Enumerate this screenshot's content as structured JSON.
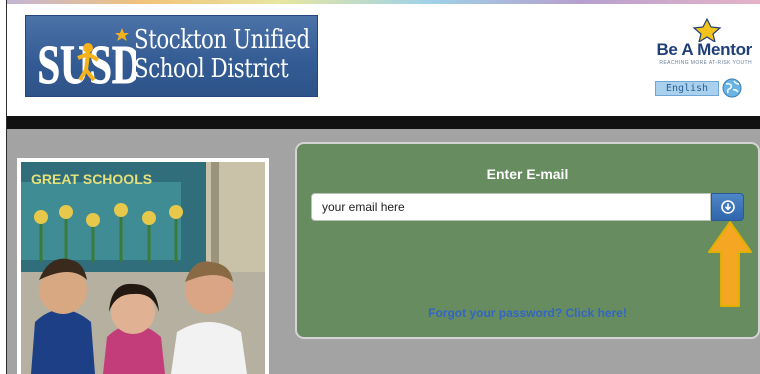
{
  "header": {
    "logo": {
      "letters": "SUSD",
      "line1": "Stockton Unified",
      "line2": "School District"
    },
    "mentor": {
      "title": "Be A Mentor",
      "tagline": "REACHING MORE AT-RISK YOUTH"
    },
    "language": {
      "label": "English",
      "icon": "globe-icon"
    }
  },
  "login": {
    "title": "Enter E-mail",
    "email_value": "",
    "email_placeholder": "your email here",
    "submit_icon": "arrow-down-circle-icon",
    "forgot_link": "Forgot your password? Click here!"
  },
  "annotation": {
    "arrow_icon": "up-arrow-icon",
    "arrow_color": "#f5a623"
  },
  "photo": {
    "sign_text": "GREAT SCHOOLS"
  },
  "colors": {
    "panel_green": "#668c5f",
    "button_blue": "#3a72b8",
    "logo_blue": "#3d6399",
    "link_blue": "#3366c4"
  }
}
